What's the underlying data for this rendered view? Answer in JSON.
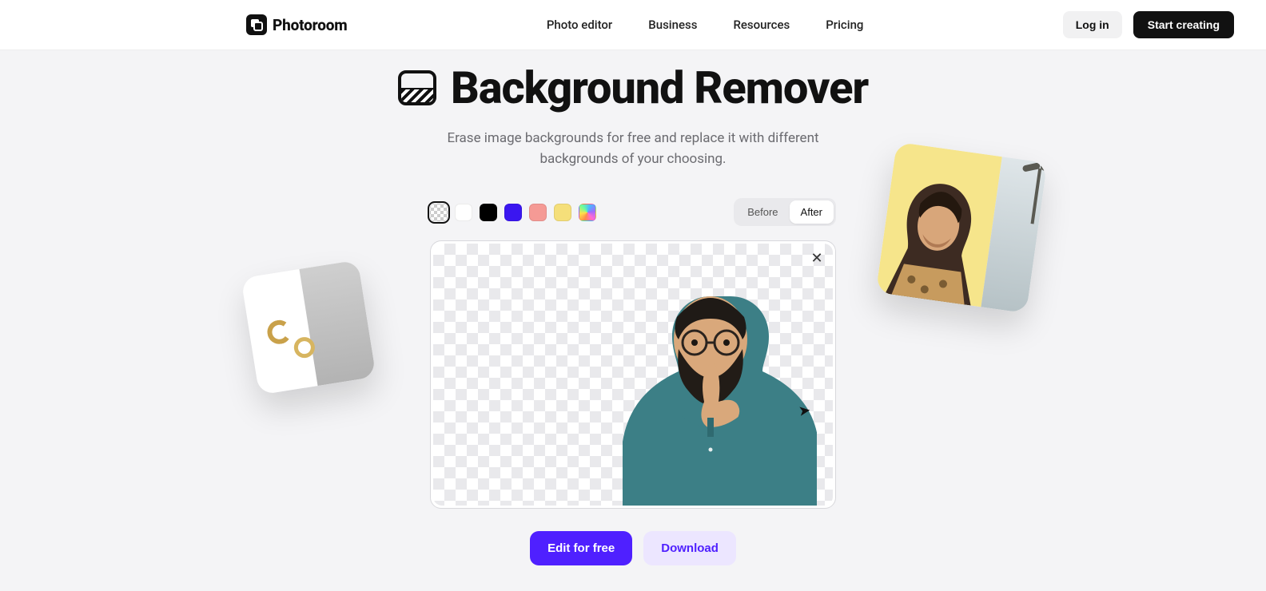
{
  "brand": "Photoroom",
  "nav": {
    "items": [
      "Photo editor",
      "Business",
      "Resources",
      "Pricing"
    ]
  },
  "header_buttons": {
    "login": "Log in",
    "start": "Start creating"
  },
  "page": {
    "title": "Background Remover",
    "subtitle": "Erase image backgrounds for free and replace it with different backgrounds of your choosing."
  },
  "swatches": [
    {
      "name": "transparent",
      "selected": true
    },
    {
      "name": "white",
      "color": "#ffffff"
    },
    {
      "name": "black",
      "color": "#000000"
    },
    {
      "name": "blue",
      "color": "#3a16f0"
    },
    {
      "name": "salmon",
      "color": "#f59a95"
    },
    {
      "name": "yellow",
      "color": "#f5df7a"
    },
    {
      "name": "gradient"
    }
  ],
  "toggle": {
    "before": "Before",
    "after": "After",
    "active": "after"
  },
  "cta": {
    "edit": "Edit for free",
    "download": "Download"
  },
  "colors": {
    "accent_purple": "#4f20ff",
    "accent_light": "#ece6ff"
  }
}
